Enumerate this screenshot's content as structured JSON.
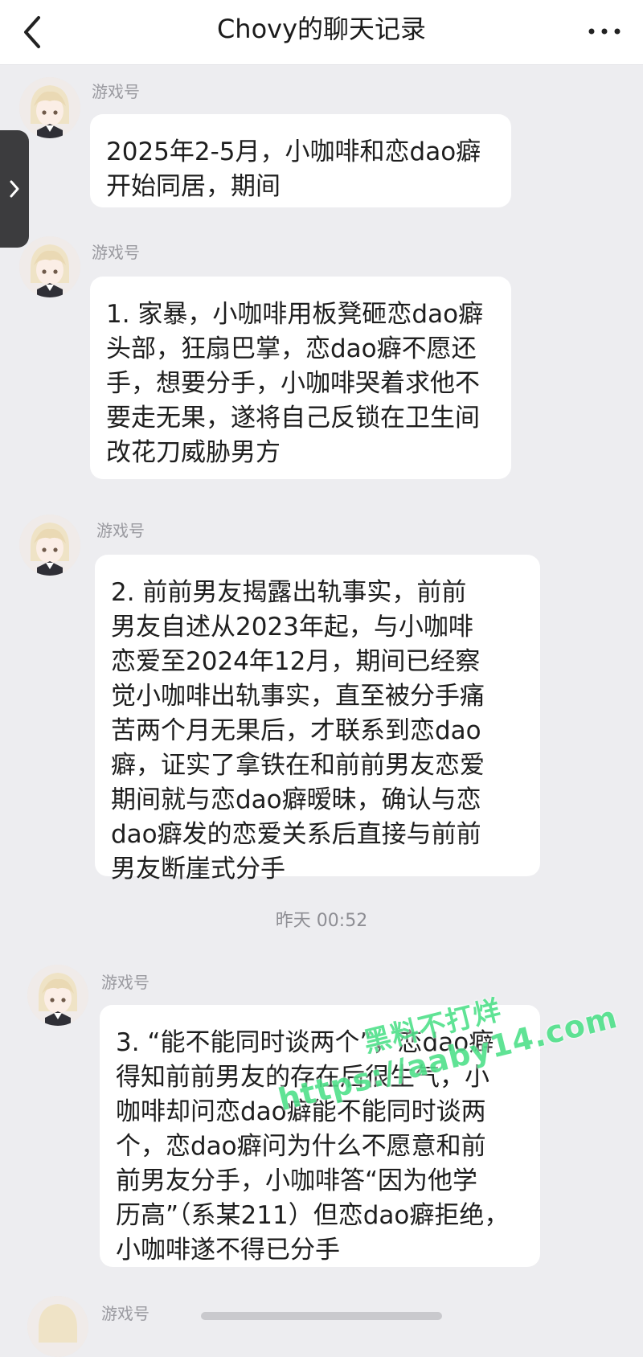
{
  "header": {
    "title": "Chovy的聊天记录",
    "back_icon": "chevron-left-icon",
    "more_icon": "ellipsis-icon"
  },
  "side_tab": {
    "icon": "chevron-right-icon"
  },
  "messages": [
    {
      "sender": "游戏号",
      "text": "2025年2-5月，小咖啡和恋dao癖\n开始同居，期间"
    },
    {
      "sender": "游戏号",
      "text": "1. 家暴，小咖啡用板凳砸恋dao癖\n头部，狂扇巴掌，恋dao癖不愿还\n手，想要分手，小咖啡哭着求他不\n要走无果，遂将自己反锁在卫生间\n改花刀威胁男方"
    },
    {
      "sender": "游戏号",
      "text": "2. 前前男友揭露出轨事实，前前\n男友自述从2023年起，与小咖啡\n恋爱至2024年12月，期间已经察\n觉小咖啡出轨事实，直至被分手痛\n苦两个月无果后，才联系到恋dao\n癖，证实了拿铁在和前前男友恋爱\n期间就与恋dao癖暧昧，确认与恋\ndao癖发的恋爱关系后直接与前前\n男友断崖式分手"
    },
    {
      "sender": "游戏号",
      "text": "3. “能不能同时谈两个”，恋dao癖\n得知前前男友的存在后很生气，小\n咖啡却问恋dao癖能不能同时谈两\n个，恋dao癖问为什么不愿意和前\n前男友分手，小咖啡答“因为他学\n历高”（系某211）但恋dao癖拒绝，\n小咖啡遂不得已分手"
    },
    {
      "sender": "游戏号",
      "text": ""
    }
  ],
  "timestamp": "昨天 00:52",
  "watermark": {
    "line1": "黑料不打烊",
    "line2": "https://aaby14.com"
  },
  "colors": {
    "background": "#ededf0",
    "bubble": "#ffffff",
    "watermark": "#4fe08a"
  }
}
